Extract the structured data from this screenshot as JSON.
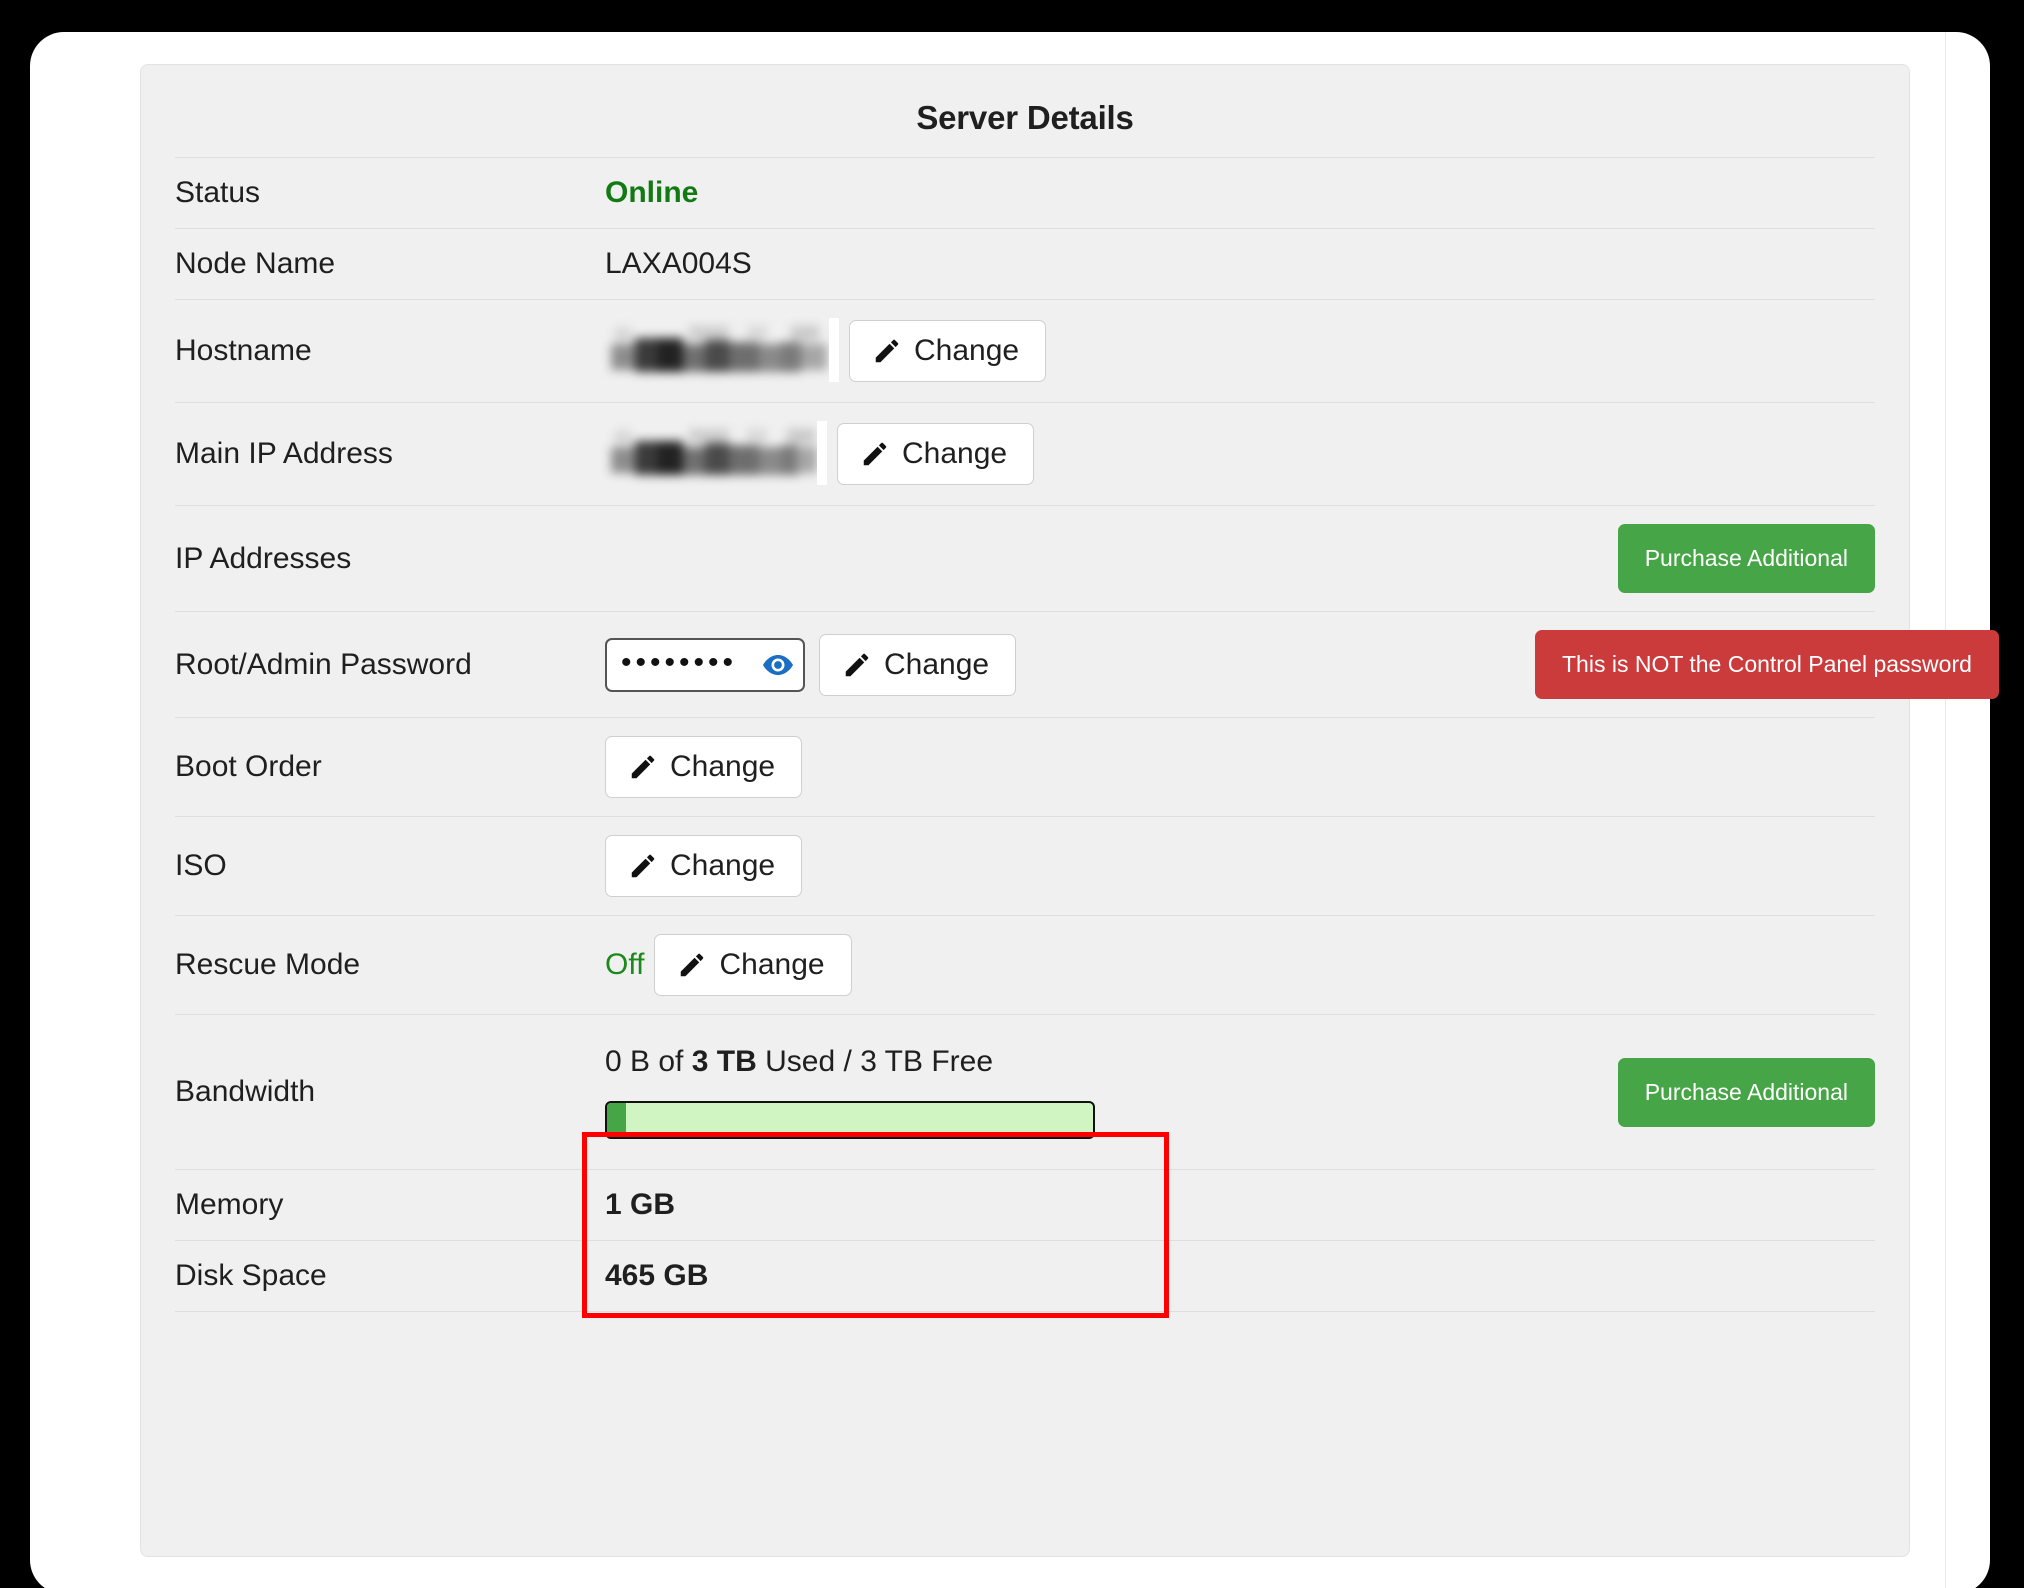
{
  "card": {
    "title": "Server Details"
  },
  "rows": {
    "status": {
      "label": "Status",
      "value": "Online"
    },
    "node_name": {
      "label": "Node Name",
      "value": "LAXA004S"
    },
    "hostname": {
      "label": "Hostname",
      "value": "",
      "redacted": "redacted-hostname",
      "change_label": "Change"
    },
    "main_ip": {
      "label": "Main IP Address",
      "value": "",
      "redacted": "redacted-ip-address",
      "change_label": "Change"
    },
    "ip_addresses": {
      "label": "IP Addresses",
      "purchase_label": "Purchase Additional"
    },
    "root_password": {
      "label": "Root/Admin Password",
      "masked_value": "••••••••",
      "reveal_icon": "eye-icon",
      "change_label": "Change",
      "warning_label": "This is NOT the Control Panel password"
    },
    "boot_order": {
      "label": "Boot Order",
      "change_label": "Change"
    },
    "iso": {
      "label": "ISO",
      "change_label": "Change"
    },
    "rescue_mode": {
      "label": "Rescue Mode",
      "value": "Off",
      "change_label": "Change"
    },
    "bandwidth": {
      "label": "Bandwidth",
      "used": "0 B",
      "of_word": "of",
      "total": "3 TB",
      "used_word": "Used",
      "separator": "/",
      "free": "3 TB Free",
      "percent_used": 4,
      "purchase_label": "Purchase Additional"
    },
    "memory": {
      "label": "Memory",
      "value": "1 GB"
    },
    "disk_space": {
      "label": "Disk Space",
      "value": "465 GB"
    }
  },
  "colors": {
    "status_green": "#127a12",
    "button_green": "#46a546",
    "button_red": "#cc3b3b",
    "progress_track": "#d1f5c2",
    "annotation_red": "#ff0000",
    "card_background": "#f0f0f0"
  },
  "annotation": {
    "target": "bandwidth-row",
    "shape": "rectangle",
    "color": "#ff0000"
  }
}
